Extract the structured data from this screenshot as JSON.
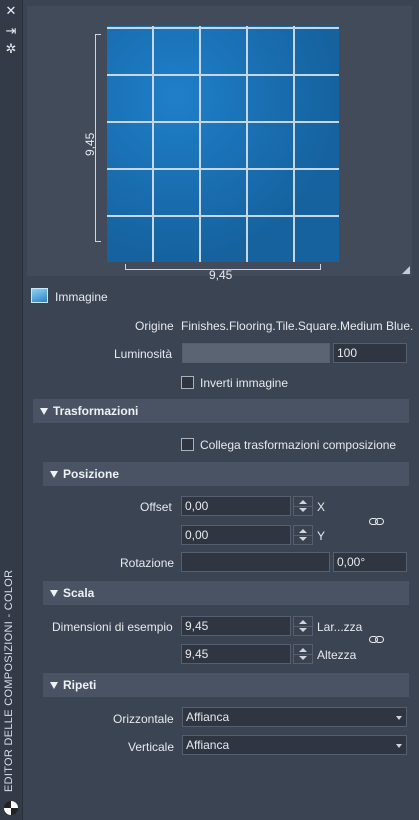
{
  "strip": {
    "vertical_title": "EDITOR DELLE COMPOSIZIONI - COLOR",
    "icons": [
      "close-icon",
      "pin-icon",
      "settings-icon"
    ]
  },
  "preview": {
    "height_dim": "9,45",
    "width_dim": "9,45"
  },
  "image_header": "Immagine",
  "origin": {
    "label": "Origine",
    "value": "Finishes.Flooring.Tile.Square.Medium Blue."
  },
  "brightness": {
    "label": "Luminosità",
    "value": "100"
  },
  "invert": {
    "label": "Inverti immagine"
  },
  "sections": {
    "transform": "Trasformazioni",
    "position": "Posizione",
    "scale": "Scala",
    "repeat": "Ripeti"
  },
  "link_transforms": "Collega trasformazioni composizione",
  "offset": {
    "label": "Offset",
    "x_value": "0,00",
    "x_label": "X",
    "y_value": "0,00",
    "y_label": "Y"
  },
  "rotation": {
    "label": "Rotazione",
    "value": "0,00°"
  },
  "scale": {
    "label": "Dimensioni di esempio",
    "width_value": "9,45",
    "width_label": "Lar...zza",
    "height_value": "9,45",
    "height_label": "Altezza"
  },
  "repeat": {
    "horizontal_label": "Orizzontale",
    "horizontal_value": "Affianca",
    "vertical_label": "Verticale",
    "vertical_value": "Affianca"
  },
  "colors": {
    "panel": "#3b4453",
    "section": "#4a5363",
    "tile": "#1a6fb3"
  }
}
